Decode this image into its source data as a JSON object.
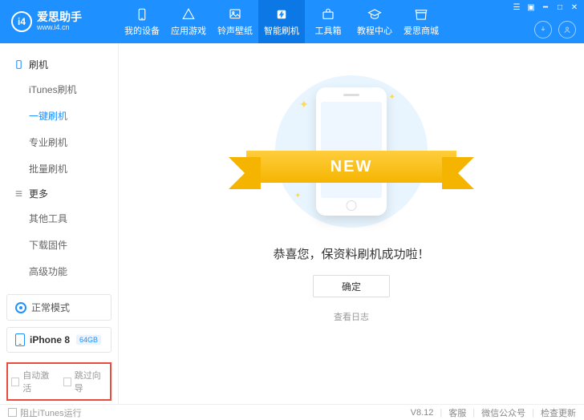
{
  "brand": {
    "title": "爱思助手",
    "url": "www.i4.cn",
    "logo_text": "i4"
  },
  "nav": {
    "items": [
      {
        "label": "我的设备"
      },
      {
        "label": "应用游戏"
      },
      {
        "label": "铃声壁纸"
      },
      {
        "label": "智能刷机"
      },
      {
        "label": "工具箱"
      },
      {
        "label": "教程中心"
      },
      {
        "label": "爱思商城"
      }
    ]
  },
  "sidebar": {
    "section1": {
      "title": "刷机",
      "items": [
        "iTunes刷机",
        "一键刷机",
        "专业刷机",
        "批量刷机"
      ]
    },
    "section2": {
      "title": "更多",
      "items": [
        "其他工具",
        "下载固件",
        "高级功能"
      ]
    },
    "mode": "正常模式",
    "device": {
      "name": "iPhone 8",
      "storage": "64GB"
    },
    "checks": {
      "auto_activate": "自动激活",
      "skip_guide": "跳过向导"
    }
  },
  "main": {
    "ribbon": "NEW",
    "message": "恭喜您，保资料刷机成功啦！",
    "ok": "确定",
    "view_log": "查看日志"
  },
  "statusbar": {
    "block_itunes": "阻止iTunes运行",
    "version": "V8.12",
    "support": "客服",
    "wechat": "微信公众号",
    "update": "检查更新"
  }
}
